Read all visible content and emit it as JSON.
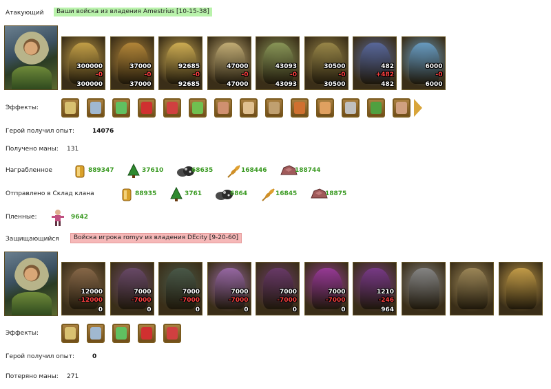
{
  "attacker": {
    "label": "Атакующий",
    "title": "Ваши войска из владения Amestrius [10-15-38]",
    "units": [
      {
        "icon": "royal-guard-unit-icon",
        "count": "300000",
        "lost": "-0",
        "left": "300000",
        "color": "#c9a449"
      },
      {
        "icon": "archer-unit-icon",
        "count": "37000",
        "lost": "-0",
        "left": "37000",
        "color": "#b88a3a"
      },
      {
        "icon": "knight-unit-icon",
        "count": "92685",
        "lost": "-0",
        "left": "92685",
        "color": "#d4b255"
      },
      {
        "icon": "pegasus-knight-unit-icon",
        "count": "47000",
        "lost": "-0",
        "left": "47000",
        "color": "#c8b279"
      },
      {
        "icon": "crossbowman-unit-icon",
        "count": "43093",
        "lost": "-0",
        "left": "43093",
        "color": "#8c9a5a"
      },
      {
        "icon": "monk-unit-icon",
        "count": "30500",
        "lost": "-0",
        "left": "30500",
        "color": "#9c8a4a"
      },
      {
        "icon": "paladin-unit-icon",
        "count": "482",
        "lost": "+482",
        "left": "482",
        "color": "#5a6aa0"
      },
      {
        "icon": "angel-unit-icon",
        "count": "6000",
        "lost": "-0",
        "left": "6000",
        "color": "#6aa0c8"
      }
    ],
    "effects_label": "Эффекты:",
    "effects": [
      "skull-shield-effect-icon",
      "skull-arrows-effect-icon",
      "sword-effect-icon",
      "heart-effect-icon",
      "heart-plus-effect-icon",
      "potion-effect-icon",
      "horn-effect-icon",
      "scroll-effect-icon",
      "shield-round-effect-icon",
      "shield-orange-effect-icon",
      "fist-effect-icon",
      "skull-bone-effect-icon",
      "frog-effect-icon",
      "hand-shield-effect-icon"
    ],
    "exp_label": "Герой получил опыт:",
    "exp_value": "14076",
    "mana_label": "Получено маны:",
    "mana_value": "131",
    "loot_label": "Награбленное",
    "loot": [
      {
        "icon": "gold-icon",
        "value": "889347"
      },
      {
        "icon": "wood-icon",
        "value": "37610"
      },
      {
        "icon": "ore-icon",
        "value": "68635"
      },
      {
        "icon": "wheat-icon",
        "value": "168446"
      },
      {
        "icon": "stone-icon",
        "value": "188744"
      }
    ],
    "clan_label": "Отправлено в Склад клана",
    "clan": [
      {
        "icon": "gold-icon",
        "value": "88935"
      },
      {
        "icon": "wood-icon",
        "value": "3761"
      },
      {
        "icon": "ore-icon",
        "value": "6864"
      },
      {
        "icon": "wheat-icon",
        "value": "16845"
      },
      {
        "icon": "stone-icon",
        "value": "18875"
      }
    ],
    "prisoners_label": "Пленные:",
    "prisoners_value": "9642"
  },
  "defender": {
    "label": "Защищающийся",
    "title": "Войска игрока romyv из владения DEcity [9-20-60]",
    "units": [
      {
        "icon": "golem-unit-icon",
        "count": "12000",
        "lost": "-12000",
        "left": "0",
        "color": "#8a6a4a"
      },
      {
        "icon": "assassin-unit-icon",
        "count": "7000",
        "lost": "-7000",
        "left": "0",
        "color": "#6a4a6a"
      },
      {
        "icon": "lizard-warrior-unit-icon",
        "count": "7000",
        "lost": "-7000",
        "left": "0",
        "color": "#4a5a4a"
      },
      {
        "icon": "harpy-unit-icon",
        "count": "7000",
        "lost": "-7000",
        "left": "0",
        "color": "#9a6aa8"
      },
      {
        "icon": "dark-archer-unit-icon",
        "count": "7000",
        "lost": "-7000",
        "left": "0",
        "color": "#6a3a6a"
      },
      {
        "icon": "sorceress-unit-icon",
        "count": "7000",
        "lost": "-7000",
        "left": "0",
        "color": "#9a3a9a"
      },
      {
        "icon": "death-knight-unit-icon",
        "count": "1210",
        "lost": "-246",
        "left": "964",
        "color": "#7a3a8a"
      },
      {
        "icon": "spider-unit-icon",
        "count": "",
        "lost": "",
        "left": "",
        "color": "#888888"
      },
      {
        "icon": "slime-unit-icon",
        "count": "",
        "lost": "",
        "left": "",
        "color": "#a08a5a"
      },
      {
        "icon": "orb-shrine-unit-icon",
        "count": "",
        "lost": "",
        "left": "",
        "color": "#c8a04a"
      }
    ],
    "effects_label": "Эффекты:",
    "effects": [
      "skull-shield-effect-icon",
      "skull-arrows-effect-icon",
      "sword-effect-icon",
      "claws-effect-icon",
      "skull-bone-effect-icon"
    ],
    "exp_label": "Герой получил опыт:",
    "exp_value": "0",
    "mana_label": "Потеряно маны:",
    "mana_value": "271"
  }
}
